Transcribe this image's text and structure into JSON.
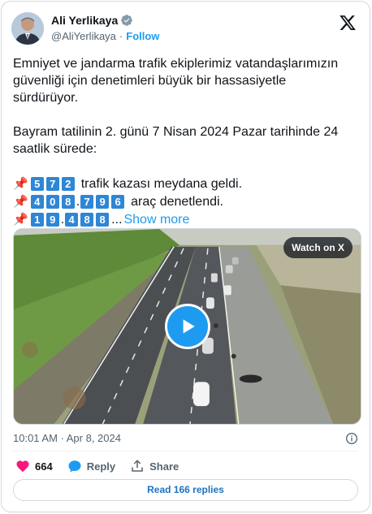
{
  "author": {
    "name": "Ali Yerlikaya",
    "handle": "@AliYerlikaya",
    "follow_label": "Follow",
    "separator": "·"
  },
  "tweet": {
    "paragraph1": "Emniyet ve jandarma trafik ekiplerimiz vatandaşlarımızın\ngüvenliği için denetimleri büyük bir hassasiyetle\nsürdürüyor.",
    "paragraph2": "Bayram tatilinin 2. günü 7 Nisan 2024 Pazar tarihinde 24\nsaatlik sürede:",
    "stats": [
      {
        "digits": [
          "5",
          "7",
          "2"
        ],
        "text": "trafik kazası meydana geldi."
      },
      {
        "digits": [
          "4",
          "0",
          "8",
          ".",
          "7",
          "9",
          "6"
        ],
        "text": "araç denetlendi."
      },
      {
        "digits": [
          "1",
          "9",
          ".",
          "4",
          "8",
          "8"
        ],
        "text": "..."
      }
    ],
    "show_more_label": "Show more"
  },
  "media": {
    "watch_label": "Watch on X"
  },
  "meta": {
    "timestamp": "10:01 AM · Apr 8, 2024"
  },
  "actions": {
    "like_count": "664",
    "reply_label": "Reply",
    "share_label": "Share",
    "read_replies_label": "Read 166 replies"
  },
  "colors": {
    "accent": "#1d9bf0",
    "like": "#f91880",
    "keycap": "#2e86d6",
    "pin": "#d93636"
  }
}
